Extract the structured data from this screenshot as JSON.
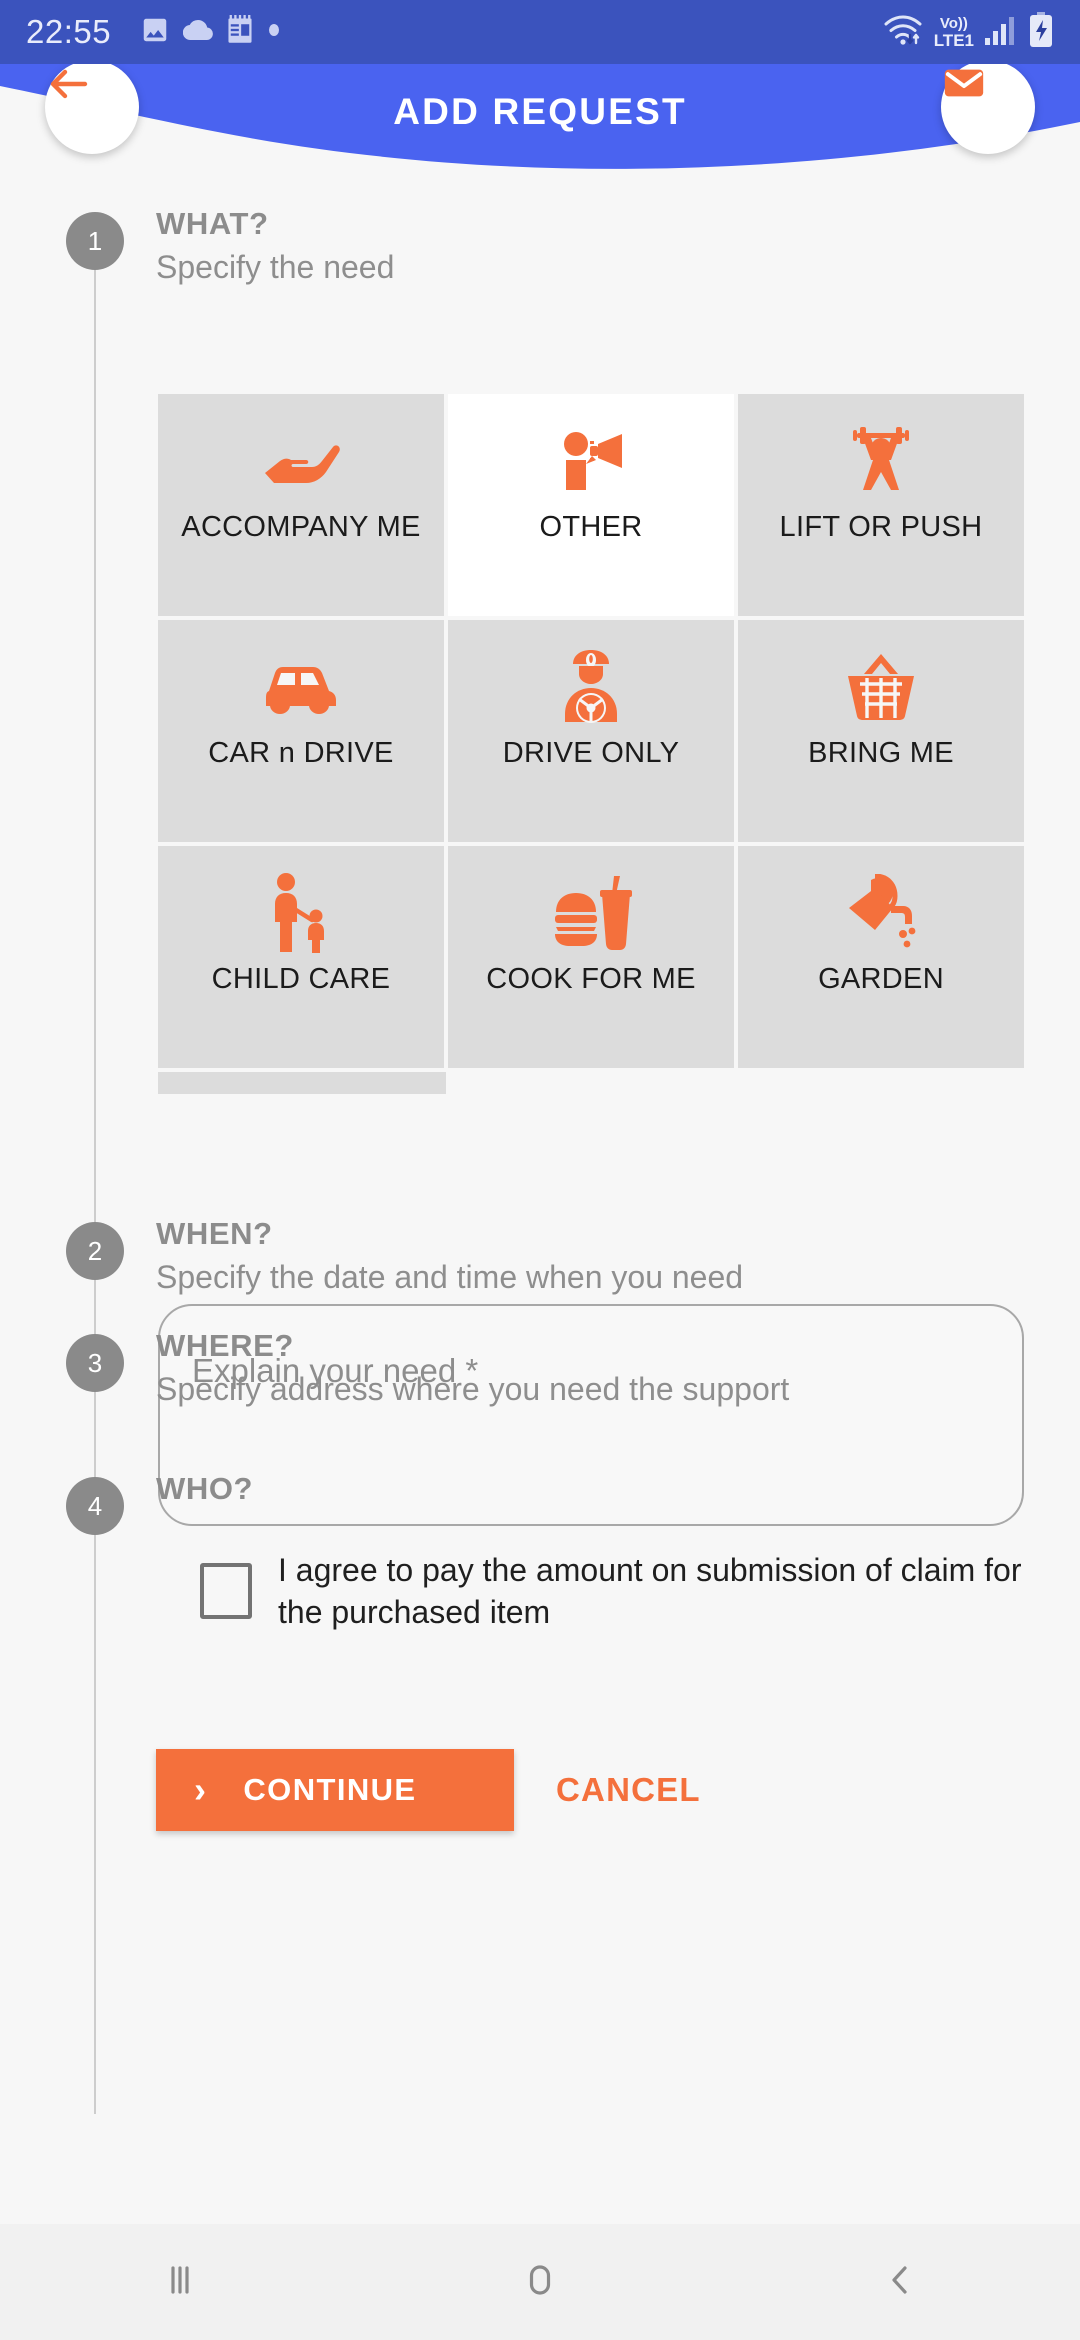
{
  "status_bar": {
    "time": "22:55",
    "left_icons": [
      "image-icon",
      "cloud-icon",
      "calendar-icon",
      "dot-icon"
    ],
    "network_label_top": "Vo))",
    "network_label_bottom": "LTE1",
    "right_icons": [
      "wifi-icon",
      "volte-icon",
      "signal-icon",
      "battery-charging-icon"
    ],
    "bg_color": "#3b53bd"
  },
  "header": {
    "title": "ADD REQUEST",
    "back_icon": "arrow-left-icon",
    "mail_icon": "envelope-icon",
    "bg_color": "#4a63f0",
    "accent_color": "#f4703c"
  },
  "steps": [
    {
      "number": "1",
      "title": "WHAT?",
      "subtitle": "Specify the need"
    },
    {
      "number": "2",
      "title": "WHEN?",
      "subtitle": "Specify the date and time when you need"
    },
    {
      "number": "3",
      "title": "WHERE?",
      "subtitle": "Specify address where you need the support"
    },
    {
      "number": "4",
      "title": "WHO?",
      "subtitle": ""
    }
  ],
  "categories": [
    {
      "label": "ACCOMPANY ME",
      "icon": "open-hand-icon",
      "selected": false
    },
    {
      "label": "OTHER",
      "icon": "megaphone-icon",
      "selected": true
    },
    {
      "label": "LIFT OR PUSH",
      "icon": "weightlifter-icon",
      "selected": false
    },
    {
      "label": "CAR n DRIVE",
      "icon": "car-icon",
      "selected": false
    },
    {
      "label": "DRIVE ONLY",
      "icon": "chauffeur-icon",
      "selected": false
    },
    {
      "label": "BRING ME",
      "icon": "basket-icon",
      "selected": false
    },
    {
      "label": "CHILD CARE",
      "icon": "adult-child-icon",
      "selected": false
    },
    {
      "label": "COOK FOR ME",
      "icon": "burger-drink-icon",
      "selected": false
    },
    {
      "label": "GARDEN",
      "icon": "watering-can-icon",
      "selected": false
    }
  ],
  "need_field": {
    "placeholder": "Explain your need *",
    "value": ""
  },
  "agreement": {
    "label": "I agree to pay the amount on submission of claim for the purchased item",
    "checked": false
  },
  "actions": {
    "continue_label": "CONTINUE",
    "continue_icon": "chevron-right-icon",
    "cancel_label": "CANCEL"
  },
  "nav_bar": {
    "recents_icon": "recents-icon",
    "home_icon": "home-icon",
    "back_icon": "back-chevron-icon"
  }
}
